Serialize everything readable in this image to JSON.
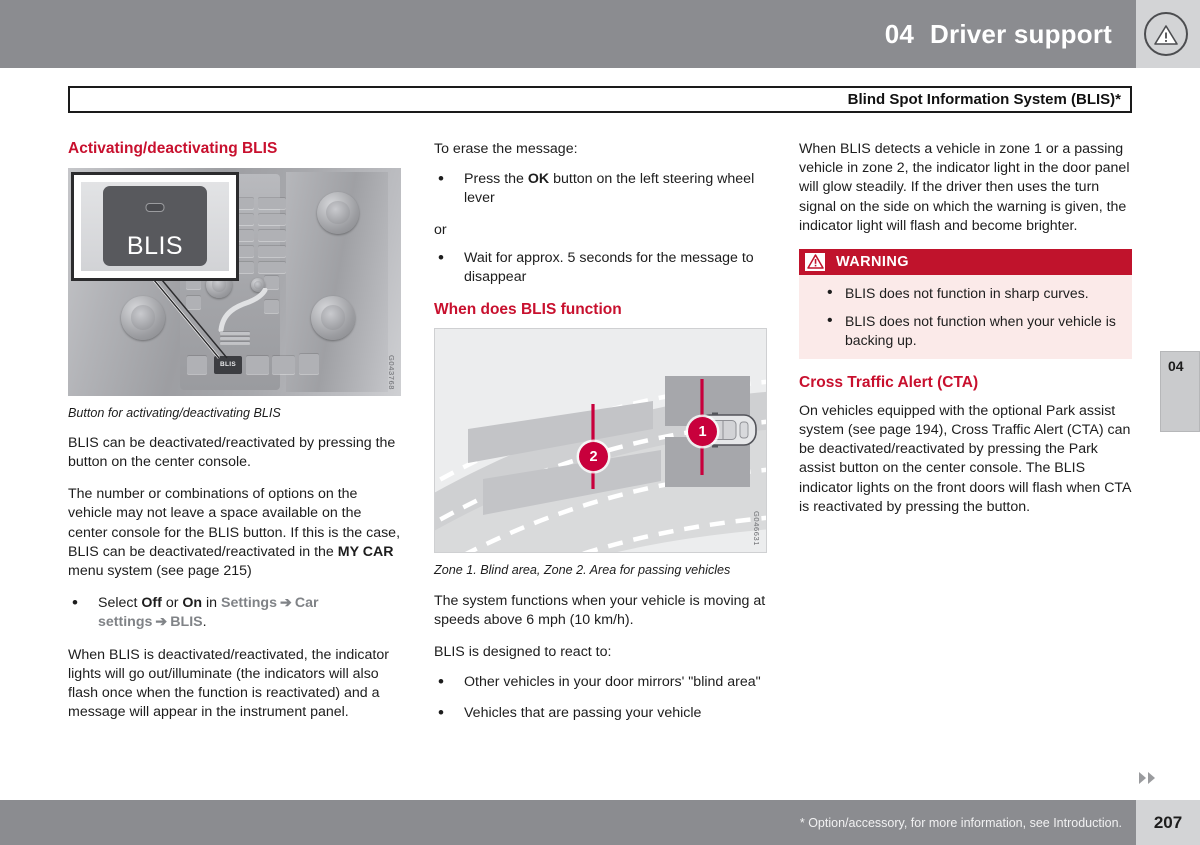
{
  "header": {
    "chapter_number": "04",
    "chapter_title": "Driver support",
    "warning_icon": "warning-triangle-icon"
  },
  "title_box": {
    "text": "Blind Spot Information System (BLIS)*"
  },
  "side_tab": {
    "label": "04"
  },
  "column_left": {
    "section_heading": "Activating/deactivating BLIS",
    "figure": {
      "name": "center-console-blis-button-photo",
      "callout_button_label": "BLIS",
      "console_button_label": "BLIS",
      "reference_code": "G043768",
      "caption": "Button for activating/deactivating BLIS"
    },
    "paragraph_1": "BLIS can be deactivated/reactivated by pressing the button on the center console.",
    "paragraph_2_part1": "The number or combinations of options on the vehicle may not leave a space available on the center console for the BLIS button. If this is the case, BLIS can be deactivated/reactivated in the ",
    "paragraph_2_bold": "MY CAR",
    "paragraph_2_part2": " menu system (see page 215)",
    "bullet_select_prefix": "Select ",
    "bullet_off": "Off",
    "bullet_or": " or ",
    "bullet_on": "On",
    "bullet_in": " in ",
    "bullet_path_1": "Settings",
    "bullet_arrow_1": "➔",
    "bullet_path_2": "Car settings",
    "bullet_arrow_2": "➔",
    "bullet_path_3": "BLIS",
    "bullet_period": ".",
    "paragraph_3": "When BLIS is deactivated/reactivated, the indicator lights will go out/illuminate (the indicators will also flash once when the function is reactivated) and a message will appear in the instrument panel."
  },
  "column_middle": {
    "erase_lead": "To erase the message:",
    "erase_bullet_1_part1": "Press the ",
    "erase_bullet_1_bold": "OK",
    "erase_bullet_1_part2": " button on the left steering wheel lever",
    "or_label": "or",
    "erase_bullet_2": "Wait for approx. 5 seconds for the message to disappear",
    "section_heading": "When does BLIS function",
    "figure": {
      "name": "blis-zones-road-diagram",
      "marker_1": "1",
      "marker_2": "2",
      "reference_code": "G046631",
      "caption": "Zone 1. Blind area, Zone 2. Area for passing vehicles"
    },
    "paragraph_1": "The system functions when your vehicle is moving at speeds above 6 mph (10 km/h).",
    "paragraph_2": "BLIS is designed to react to:",
    "react_bullet_1": "Other vehicles in your door mirrors' \"blind area\"",
    "react_bullet_2": "Vehicles that are passing your vehicle"
  },
  "column_right": {
    "paragraph_1": "When BLIS detects a vehicle in zone 1 or a passing vehicle in zone 2, the indicator light in the door panel will glow steadily. If the driver then uses the turn signal on the side on which the warning is given, the indicator light will flash and become brighter.",
    "warning": {
      "title": "WARNING",
      "icon": "warning-triangle-icon",
      "bullets": [
        "BLIS does not function in sharp curves.",
        "BLIS does not function when your vehicle is backing up."
      ]
    },
    "cta_heading": "Cross Traffic Alert (CTA)",
    "cta_paragraph": "On vehicles equipped with the optional Park assist system (see page 194), Cross Traffic Alert (CTA) can be deactivated/reactivated by pressing the Park assist button on the center console. The BLIS indicator lights on the front doors will flash when CTA is reactivated by pressing the button."
  },
  "footer": {
    "note": "* Option/accessory, for more information, see Introduction.",
    "page_number": "207"
  },
  "colors": {
    "header_gray": "#8b8c90",
    "header_light": "#d3d4d6",
    "heading_red": "#c8102e",
    "warning_red": "#c0132c",
    "warning_bg": "#fbeae9",
    "marker_crimson": "#c8003c",
    "path_gray": "#808387"
  }
}
